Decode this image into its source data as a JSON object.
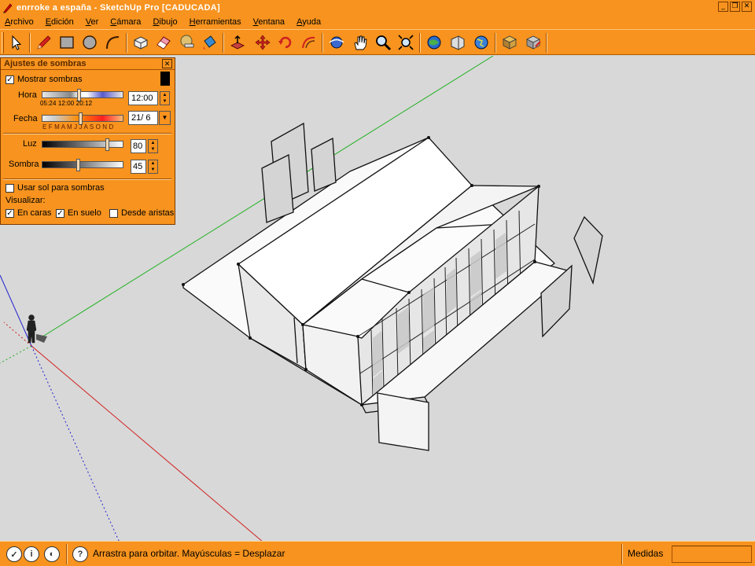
{
  "app": {
    "title": "enrroke a españa - SketchUp Pro [CADUCADA]"
  },
  "menu": [
    {
      "label": "Archivo",
      "ul": "A",
      "rest": "rchivo"
    },
    {
      "label": "Edición",
      "ul": "E",
      "rest": "dición"
    },
    {
      "label": "Ver",
      "ul": "V",
      "rest": "er"
    },
    {
      "label": "Cámara",
      "ul": "C",
      "rest": "ámara"
    },
    {
      "label": "Dibujo",
      "ul": "D",
      "rest": "ibujo"
    },
    {
      "label": "Herramientas",
      "ul": "H",
      "rest": "erramientas"
    },
    {
      "label": "Ventana",
      "ul": "V",
      "rest": "entana"
    },
    {
      "label": "Ayuda",
      "ul": "A",
      "rest": "yuda"
    }
  ],
  "toolbar": {
    "tools": [
      "select-icon",
      "pencil-icon",
      "rectangle-icon",
      "circle-icon",
      "arc-icon",
      "make-component-icon",
      "eraser-icon",
      "tape-measure-icon",
      "paint-bucket-icon",
      "push-pull-icon",
      "move-icon",
      "rotate-icon",
      "offset-icon",
      "orbit-icon",
      "pan-icon",
      "zoom-icon",
      "zoom-extents-icon",
      "get-models-icon",
      "share-model-icon",
      "google-earth-icon",
      "get-components-icon",
      "share-component-icon"
    ]
  },
  "shadow_dialog": {
    "title": "Ajustes de sombras",
    "show_shadows": {
      "label": "Mostrar sombras",
      "checked": "✓"
    },
    "time": {
      "label": "Hora",
      "ticks": "05:24       12:00       20:12",
      "value": "12:00"
    },
    "date": {
      "label": "Fecha",
      "ticks": "E F M A M J J A S O N D",
      "value": "21/ 6"
    },
    "light": {
      "label": "Luz",
      "value": "80"
    },
    "shadow": {
      "label": "Sombra",
      "value": "45"
    },
    "use_sun": {
      "label": "Usar sol para sombras",
      "checked": ""
    },
    "display_label": "Visualizar:",
    "on_faces": {
      "label": "En caras",
      "checked": "✓"
    },
    "on_ground": {
      "label": "En suelo",
      "checked": "✓"
    },
    "from_edges": {
      "label": "Desde aristas",
      "checked": ""
    }
  },
  "status": {
    "hint": "Arrastra para orbitar. Mayúsculas = Desplazar",
    "measure_label": "Medidas",
    "measure_value": ""
  },
  "colors": {
    "chrome": "#f7931e",
    "axis_red": "#d02020",
    "axis_green": "#20b020",
    "axis_blue": "#2020d0"
  }
}
